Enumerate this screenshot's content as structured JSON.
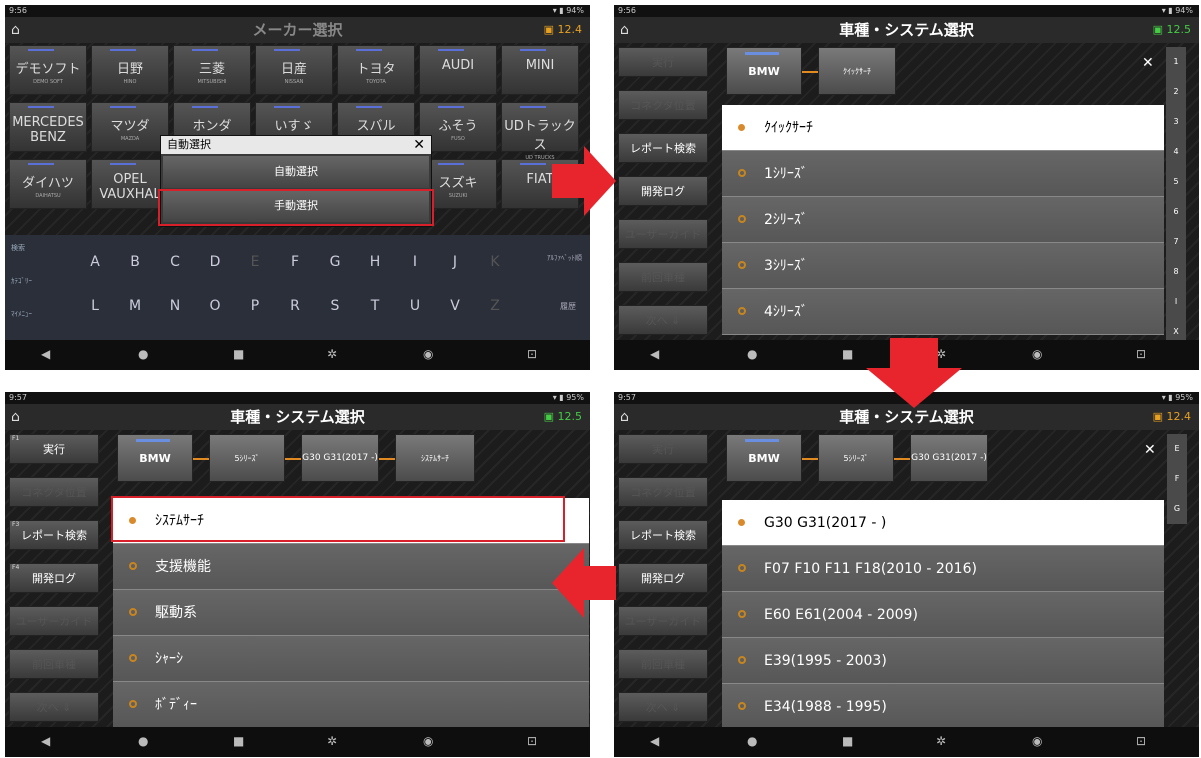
{
  "panel1": {
    "time": "9:56",
    "battery": "▾ ▮ 94%",
    "title": "メーカー選択",
    "voltage": "12.4",
    "makers_row1": [
      [
        "デモソフト",
        "DEMO SOFT"
      ],
      [
        "日野",
        "HINO"
      ],
      [
        "三菱",
        "MITSUBISHI"
      ],
      [
        "日産",
        "NISSAN"
      ],
      [
        "トヨタ",
        "TOYOTA"
      ],
      [
        "AUDI",
        ""
      ],
      [
        "MINI",
        ""
      ]
    ],
    "makers_row2": [
      [
        "MERCEDES BENZ",
        ""
      ],
      [
        "マツダ",
        "MAZDA"
      ],
      [
        "ホンダ",
        ""
      ],
      [
        "いすゞ",
        ""
      ],
      [
        "スバル",
        ""
      ],
      [
        "ふそう",
        "FUSO"
      ],
      [
        "UDトラックス",
        "UD TRUCKS"
      ]
    ],
    "makers_row3": [
      [
        "ダイハツ",
        "DAIHATSU"
      ],
      [
        "OPEL VAUXHAL",
        ""
      ],
      [
        "",
        ""
      ],
      [
        "",
        ""
      ],
      [
        "",
        ""
      ],
      [
        "スズキ",
        "SUZUKI"
      ],
      [
        "FIAT",
        ""
      ]
    ],
    "dialog_title": "自動選択",
    "dialog_opt1": "自動選択",
    "dialog_opt2": "手動選択",
    "kb_left": [
      "検索",
      "ｶﾃｺﾞﾘｰ",
      "ﾏｲﾒﾆｭｰ"
    ],
    "kb_row1": [
      "A",
      "B",
      "C",
      "D",
      "E",
      "F",
      "G",
      "H",
      "I",
      "J",
      "K"
    ],
    "kb_row2": [
      "L",
      "M",
      "N",
      "O",
      "P",
      "R",
      "S",
      "T",
      "U",
      "V",
      "Z"
    ],
    "kb_right1": "ｱﾙﾌｧﾍﾞｯﾄ順",
    "kb_right2": "履歴"
  },
  "panel2": {
    "time": "9:56",
    "battery": "▾ ▮ 94%",
    "title": "車種・システム選択",
    "voltage": "12.5",
    "side": [
      "実行",
      "コネクタ位置",
      "レポート検索",
      "開発ログ",
      "ユーザーガイド",
      "前回車種",
      "次へ ⇓"
    ],
    "crumbs": [
      "BMW",
      "ｸｲｯｸｻｰﾁ"
    ],
    "items": [
      "ｸｲｯｸｻｰﾁ",
      "1ｼﾘｰｽﾞ",
      "2ｼﾘｰｽﾞ",
      "3ｼﾘｰｽﾞ",
      "4ｼﾘｰｽﾞ"
    ],
    "scroll": [
      "1",
      "2",
      "3",
      "4",
      "5",
      "6",
      "7",
      "8",
      "I",
      "X"
    ]
  },
  "panel3": {
    "time": "9:57",
    "battery": "▾ ▮ 95%",
    "title": "車種・システム選択",
    "voltage": "12.5",
    "side": [
      "実行",
      "コネクタ位置",
      "レポート検索",
      "開発ログ",
      "ユーザーガイド",
      "前回車種",
      "次へ ⇓"
    ],
    "side_keys": [
      "F1",
      "",
      "F3",
      "F4",
      "",
      "",
      ""
    ],
    "crumbs": [
      "BMW",
      "5ｼﾘｰｽﾞ",
      "G30 G31(2017 -)",
      "ｼｽﾃﾑｻｰﾁ"
    ],
    "items": [
      "ｼｽﾃﾑｻｰﾁ",
      "支援機能",
      "駆動系",
      "ｼｬｰｼ",
      "ﾎﾞﾃﾞｨｰ"
    ]
  },
  "panel4": {
    "time": "9:57",
    "battery": "▾ ▮ 95%",
    "title": "車種・システム選択",
    "voltage": "12.4",
    "side": [
      "実行",
      "コネクタ位置",
      "レポート検索",
      "開発ログ",
      "ユーザーガイド",
      "前回車種",
      "次へ ⇓"
    ],
    "crumbs": [
      "BMW",
      "5ｼﾘｰｽﾞ",
      "G30 G31(2017 -)"
    ],
    "items": [
      "G30 G31(2017 - )",
      "F07 F10 F11 F18(2010 - 2016)",
      "E60 E61(2004 - 2009)",
      "E39(1995 - 2003)",
      "E34(1988 - 1995)"
    ],
    "scroll": [
      "E",
      "F",
      "G"
    ]
  },
  "colors": {
    "accent_red": "#e8242c",
    "selected_dot": "#d98a2b",
    "battery_green": "#44cc44"
  }
}
